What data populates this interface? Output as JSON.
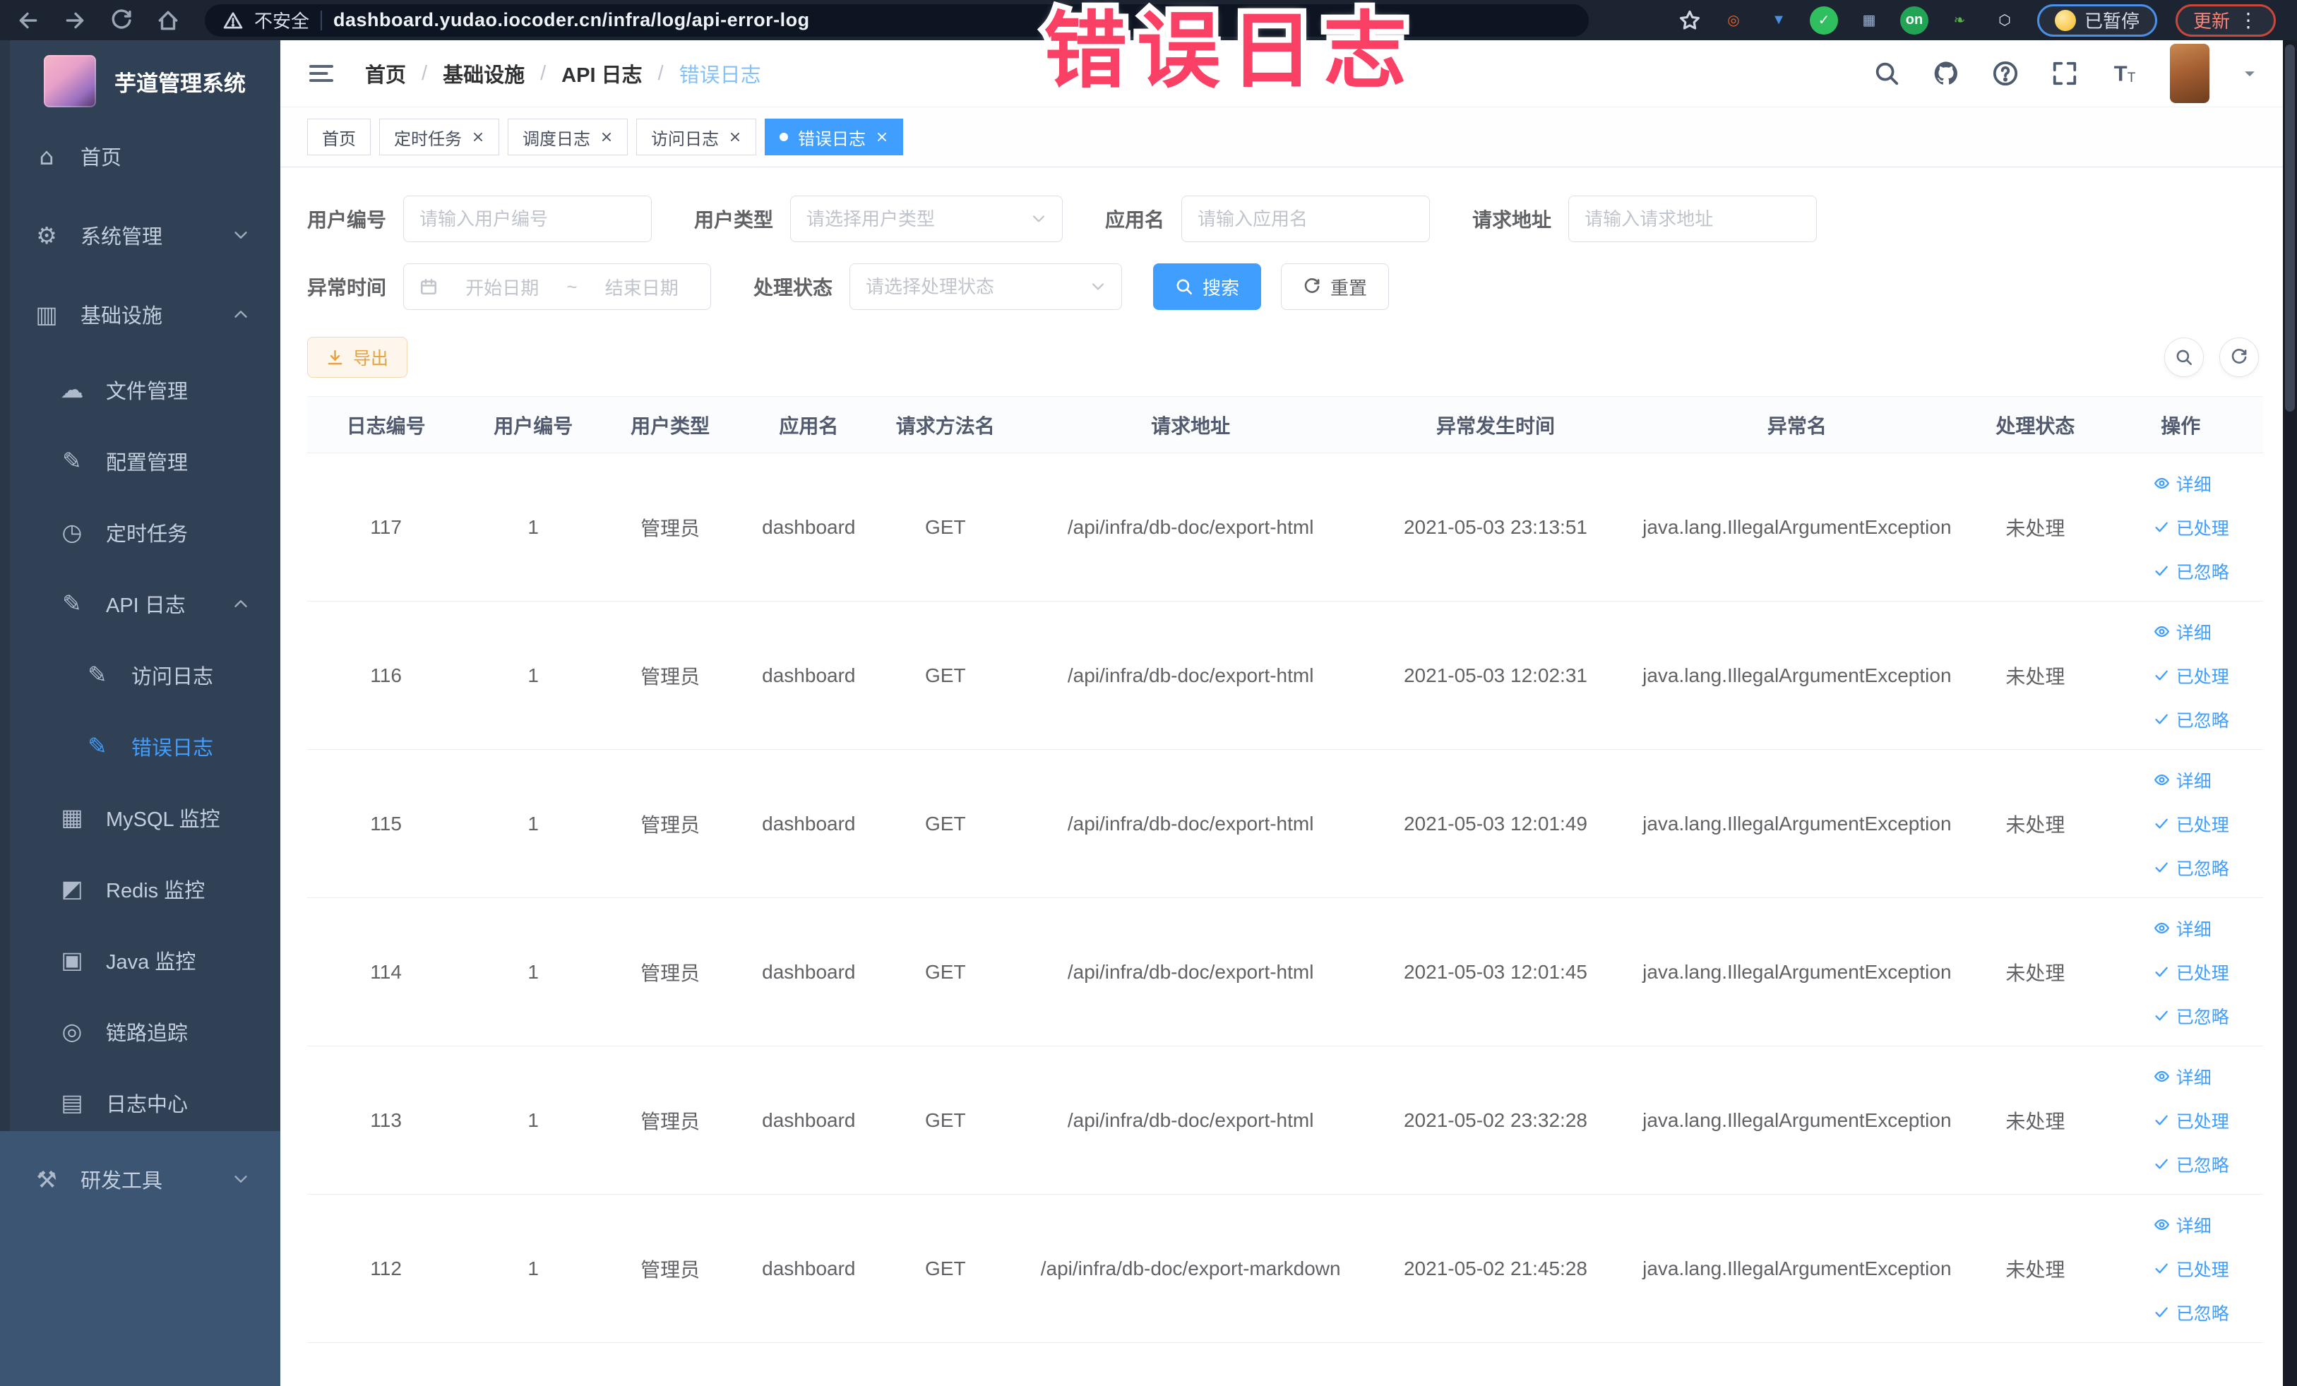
{
  "colors": {
    "accent": "#409eff",
    "warning": "#e6a23c",
    "overlay_pink": "#fb4066",
    "sidebar_bg": "#304156",
    "topbar_bg": "#1d2431"
  },
  "overlay": {
    "text": "错误日志"
  },
  "browser": {
    "security_label": "不安全",
    "url": "dashboard.yudao.iocoder.cn/infra/log/api-error-log",
    "paused_badge": "已暂停",
    "update_badge": "更新",
    "extensions": [
      {
        "name": "ext-ring-orange-icon",
        "glyph": "◎",
        "bg": "#1d2431",
        "fg": "#e8622c"
      },
      {
        "name": "ext-shield-blue-icon",
        "glyph": "▼",
        "bg": "#1d2431",
        "fg": "#4a90e2"
      },
      {
        "name": "ext-green-v-icon",
        "glyph": "✓",
        "bg": "#2fbf5f",
        "fg": "#ffffff"
      },
      {
        "name": "ext-grid-blue-icon",
        "glyph": "▦",
        "bg": "#1d2431",
        "fg": "#9fb6d8"
      },
      {
        "name": "ext-on-switch-icon",
        "glyph": "on",
        "bg": "#23a455",
        "fg": "#ffffff"
      },
      {
        "name": "ext-leaf-green-icon",
        "glyph": "❧",
        "bg": "#1d2431",
        "fg": "#57b449"
      },
      {
        "name": "ext-puzzle-icon",
        "glyph": "⬡",
        "bg": "#1d2431",
        "fg": "#e6ebf2"
      }
    ]
  },
  "sidebar": {
    "title": "芋道管理系统",
    "items": [
      {
        "label": "首页",
        "icon": "home-icon",
        "depth": 0,
        "top": true
      },
      {
        "label": "系统管理",
        "icon": "gear-icon",
        "depth": 0,
        "top": true,
        "chevron": "down"
      },
      {
        "label": "基础设施",
        "icon": "infra-icon",
        "depth": 0,
        "top": true,
        "chevron": "up"
      },
      {
        "label": "文件管理",
        "icon": "cloud-icon",
        "depth": 1
      },
      {
        "label": "配置管理",
        "icon": "edit-icon",
        "depth": 1
      },
      {
        "label": "定时任务",
        "icon": "clock-icon",
        "depth": 1
      },
      {
        "label": "API 日志",
        "icon": "log-icon",
        "depth": 1,
        "chevron": "up"
      },
      {
        "label": "访问日志",
        "icon": "log-icon",
        "depth": 2
      },
      {
        "label": "错误日志",
        "icon": "log-icon",
        "depth": 2,
        "active": true
      },
      {
        "label": "MySQL 监控",
        "icon": "mysql-icon",
        "depth": 1
      },
      {
        "label": "Redis 监控",
        "icon": "redis-icon",
        "depth": 1
      },
      {
        "label": "Java 监控",
        "icon": "java-icon",
        "depth": 1
      },
      {
        "label": "链路追踪",
        "icon": "trace-icon",
        "depth": 1
      },
      {
        "label": "日志中心",
        "icon": "log-center-icon",
        "depth": 1
      }
    ],
    "dev_section": {
      "label": "研发工具",
      "icon": "tools-icon",
      "chevron": "down"
    }
  },
  "header": {
    "breadcrumb": [
      "首页",
      "基础设施",
      "API 日志",
      "错误日志"
    ]
  },
  "tabs": [
    {
      "label": "首页",
      "closable": false,
      "active": false
    },
    {
      "label": "定时任务",
      "closable": true,
      "active": false
    },
    {
      "label": "调度日志",
      "closable": true,
      "active": false
    },
    {
      "label": "访问日志",
      "closable": true,
      "active": false
    },
    {
      "label": "错误日志",
      "closable": true,
      "active": true
    }
  ],
  "filters": {
    "user_id": {
      "label": "用户编号",
      "placeholder": "请输入用户编号"
    },
    "user_type": {
      "label": "用户类型",
      "placeholder": "请选择用户类型"
    },
    "app_name": {
      "label": "应用名",
      "placeholder": "请输入应用名"
    },
    "request_url": {
      "label": "请求地址",
      "placeholder": "请输入请求地址"
    },
    "exception_time": {
      "label": "异常时间",
      "start_placeholder": "开始日期",
      "separator": "~",
      "end_placeholder": "结束日期"
    },
    "process_status": {
      "label": "处理状态",
      "placeholder": "请选择处理状态"
    },
    "search_label": "搜索",
    "reset_label": "重置"
  },
  "toolbar": {
    "export_label": "导出"
  },
  "table": {
    "headers": [
      "日志编号",
      "用户编号",
      "用户类型",
      "应用名",
      "请求方法名",
      "请求地址",
      "异常发生时间",
      "异常名",
      "处理状态",
      "操作"
    ],
    "row_actions": [
      "详细",
      "已处理",
      "已忽略"
    ],
    "rows": [
      {
        "id": "117",
        "user_id": "1",
        "user_type": "管理员",
        "app_name": "dashboard",
        "method": "GET",
        "url": "/api/infra/db-doc/export-html",
        "time": "2021-05-03 23:13:51",
        "exception": "java.lang.IllegalArgumentException",
        "status": "未处理"
      },
      {
        "id": "116",
        "user_id": "1",
        "user_type": "管理员",
        "app_name": "dashboard",
        "method": "GET",
        "url": "/api/infra/db-doc/export-html",
        "time": "2021-05-03 12:02:31",
        "exception": "java.lang.IllegalArgumentException",
        "status": "未处理"
      },
      {
        "id": "115",
        "user_id": "1",
        "user_type": "管理员",
        "app_name": "dashboard",
        "method": "GET",
        "url": "/api/infra/db-doc/export-html",
        "time": "2021-05-03 12:01:49",
        "exception": "java.lang.IllegalArgumentException",
        "status": "未处理"
      },
      {
        "id": "114",
        "user_id": "1",
        "user_type": "管理员",
        "app_name": "dashboard",
        "method": "GET",
        "url": "/api/infra/db-doc/export-html",
        "time": "2021-05-03 12:01:45",
        "exception": "java.lang.IllegalArgumentException",
        "status": "未处理"
      },
      {
        "id": "113",
        "user_id": "1",
        "user_type": "管理员",
        "app_name": "dashboard",
        "method": "GET",
        "url": "/api/infra/db-doc/export-html",
        "time": "2021-05-02 23:32:28",
        "exception": "java.lang.IllegalArgumentException",
        "status": "未处理"
      },
      {
        "id": "112",
        "user_id": "1",
        "user_type": "管理员",
        "app_name": "dashboard",
        "method": "GET",
        "url": "/api/infra/db-doc/export-markdown",
        "time": "2021-05-02 21:45:28",
        "exception": "java.lang.IllegalArgumentException",
        "status": "未处理"
      }
    ]
  }
}
